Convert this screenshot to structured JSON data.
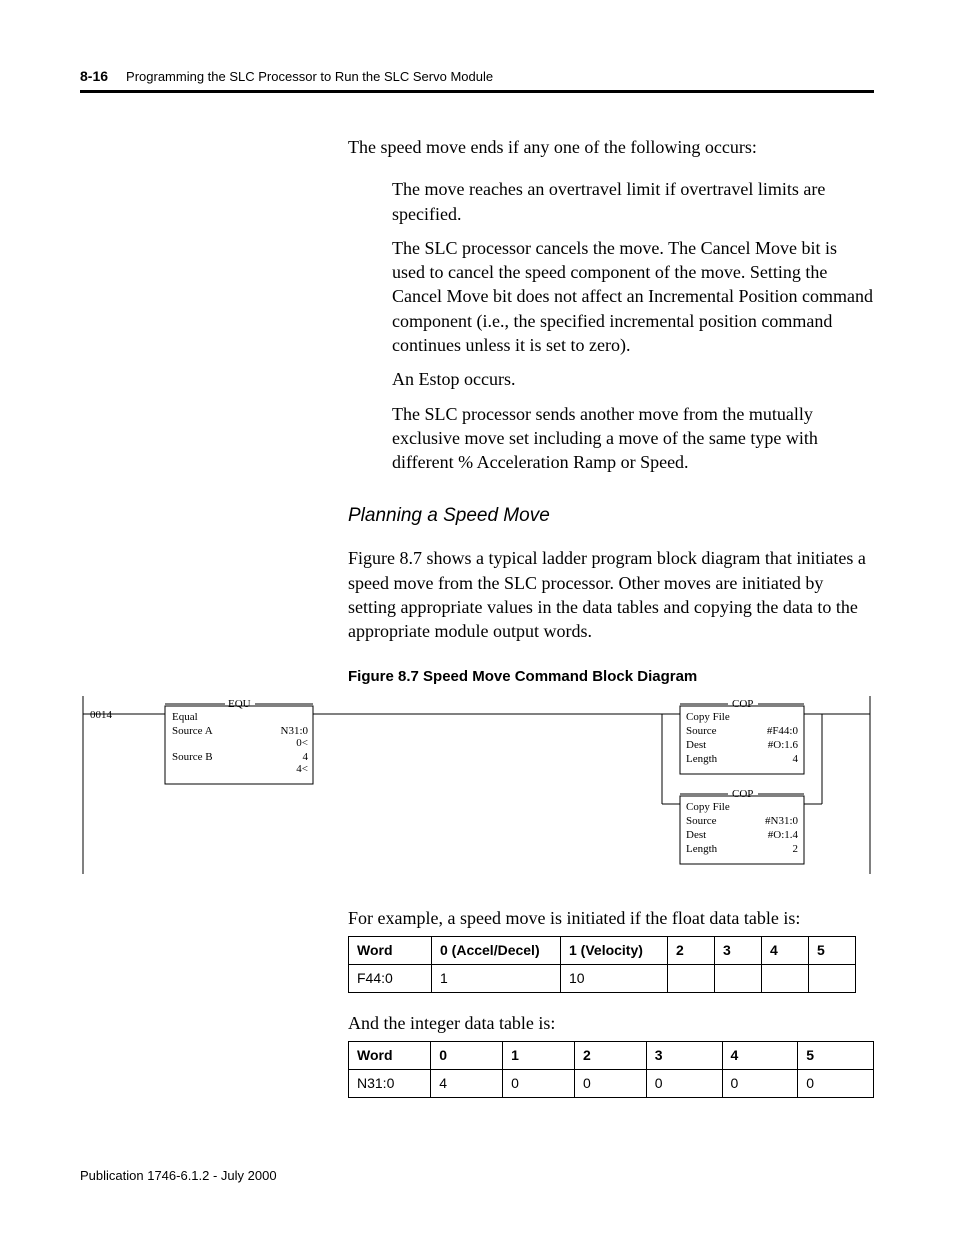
{
  "header": {
    "page_no": "8-16",
    "chapter_title": "Programming the SLC Processor to Run the SLC Servo Module"
  },
  "body": {
    "intro": "The speed move ends if any one of the following occurs:",
    "bullets": [
      "The move reaches an overtravel limit if overtravel limits are specified.",
      "The SLC processor cancels the move. The Cancel Move bit is used to cancel the speed component of the move. Setting the Cancel Move bit does not affect an Incremental Position command component (i.e., the specified incremental position command continues unless it is set to zero).",
      "An Estop occurs.",
      "The SLC processor sends another move from the mutually exclusive move set including a move of the same type with different % Acceleration Ramp or Speed."
    ],
    "subhead": "Planning a Speed Move",
    "sub_para": "Figure 8.7 shows a typical ladder program block diagram that initiates a speed move from the SLC processor. Other moves are initiated by setting appropriate values in the data tables and copying the data to the appropriate module output words.",
    "figure_caption": "Figure 8.7 Speed Move Command Block Diagram",
    "after_fig": "For example, a speed move is initiated if the float data table is:",
    "mid": "And the integer data table is:"
  },
  "diagram": {
    "rung_no": "0014",
    "equ": {
      "title": "EQU",
      "desc": "Equal",
      "rows": [
        {
          "label": "Source A",
          "val": "N31:0",
          "sub": "0<"
        },
        {
          "label": "Source B",
          "val": "4",
          "sub": "4<"
        }
      ]
    },
    "cop1": {
      "title": "COP",
      "desc": "Copy File",
      "rows": [
        {
          "label": "Source",
          "val": "#F44:0"
        },
        {
          "label": "Dest",
          "val": "#O:1.6"
        },
        {
          "label": "Length",
          "val": "4"
        }
      ]
    },
    "cop2": {
      "title": "COP",
      "desc": "Copy File",
      "rows": [
        {
          "label": "Source",
          "val": "#N31:0"
        },
        {
          "label": "Dest",
          "val": "#O:1.4"
        },
        {
          "label": "Length",
          "val": "2"
        }
      ]
    }
  },
  "table1": {
    "headers": [
      "Word",
      "0 (Accel/Decel)",
      "1 (Velocity)",
      "2",
      "3",
      "4",
      "5"
    ],
    "row": [
      "F44:0",
      "1",
      "10",
      "",
      "",
      "",
      ""
    ]
  },
  "table2": {
    "headers": [
      "Word",
      "0",
      "1",
      "2",
      "3",
      "4",
      "5"
    ],
    "row": [
      "N31:0",
      "4",
      "0",
      "0",
      "0",
      "0",
      "0"
    ]
  },
  "footer": "Publication 1746-6.1.2 - July 2000"
}
